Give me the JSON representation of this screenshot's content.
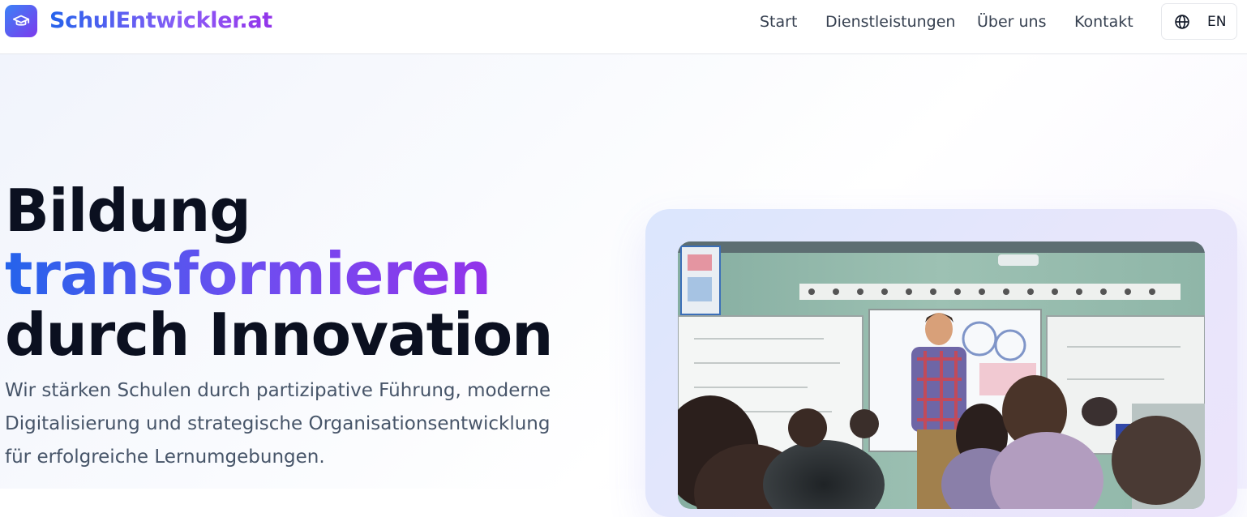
{
  "brand": {
    "name": "SchulEntwickler.at",
    "logo_icon": "graduation-cap-icon"
  },
  "nav": {
    "items": [
      {
        "label": "Start"
      },
      {
        "label": "Dienstleistungen"
      },
      {
        "label": "Über uns"
      },
      {
        "label": "Kontakt"
      }
    ],
    "language": {
      "icon": "globe-icon",
      "code": "EN"
    }
  },
  "hero": {
    "title_line1": "Bildung",
    "title_line2": "transformieren",
    "title_line3": "durch Innovation",
    "lead": "Wir stärken Schulen durch partizipative Führung, moderne Digitalisierung und strategische Organisationsentwicklung für erfolgreiche Lernumgebungen.",
    "image": "classroom-photo"
  },
  "colors": {
    "accent_blue": "#2563eb",
    "accent_purple": "#9333ea",
    "text_dark": "#0b1020",
    "text_muted": "#475569"
  }
}
